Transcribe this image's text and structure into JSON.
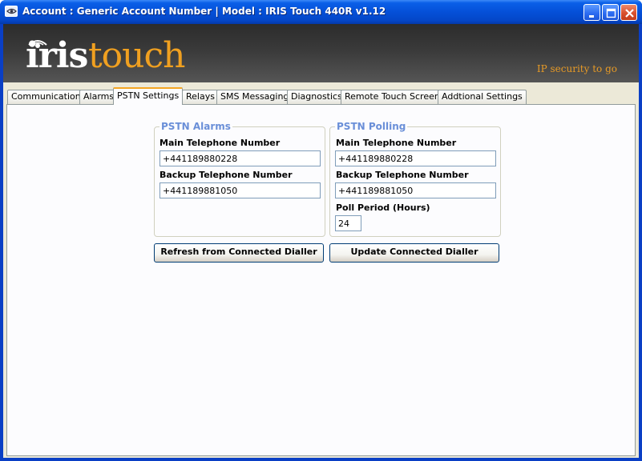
{
  "window": {
    "title": "Account : Generic Account Number  |  Model : IRIS Touch 440R v1.12"
  },
  "banner": {
    "logo_iris": "iris",
    "logo_touch": "touch",
    "tagline": "IP security to go"
  },
  "tabs": [
    {
      "label": "Communications"
    },
    {
      "label": "Alarms"
    },
    {
      "label": "PSTN Settings"
    },
    {
      "label": "Relays"
    },
    {
      "label": "SMS Messaging"
    },
    {
      "label": "Diagnostics"
    },
    {
      "label": "Remote Touch Screen"
    },
    {
      "label": "Addtional Settings"
    }
  ],
  "pstn_alarms": {
    "title": "PSTN Alarms",
    "main_label": "Main Telephone Number",
    "main_value": "+441189880228",
    "backup_label": "Backup Telephone Number",
    "backup_value": "+441189881050"
  },
  "pstn_polling": {
    "title": "PSTN Polling",
    "main_label": "Main Telephone Number",
    "main_value": "+441189880228",
    "backup_label": "Backup Telephone Number",
    "backup_value": "+441189881050",
    "poll_label": "Poll Period (Hours)",
    "poll_value": "24"
  },
  "buttons": {
    "refresh": "Refresh from Connected Dialler",
    "update": "Update Connected Dialler"
  },
  "colors": {
    "titlebar": "#0550d8",
    "accent_orange": "#f0a020",
    "group_title": "#6a8fd8",
    "active_tab_highlight": "#f5a623"
  }
}
